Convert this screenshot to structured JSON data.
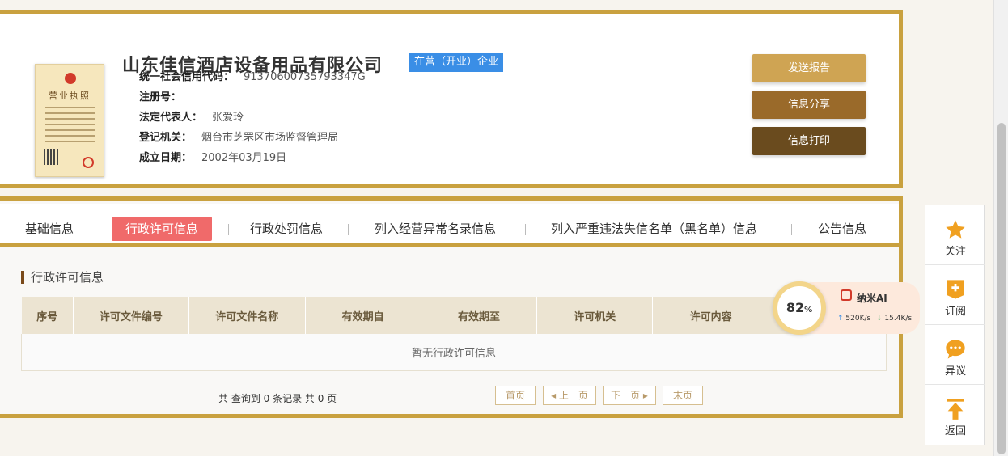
{
  "company": {
    "name": "山东佳信酒店设备用品有限公司",
    "status": "在营（开业）企业",
    "license_title": "营业执照",
    "fields": [
      {
        "label": "统一社会信用代码：",
        "value": "91370600735793347G"
      },
      {
        "label": "注册号：",
        "value": ""
      },
      {
        "label": "法定代表人：",
        "value": "张爱玲"
      },
      {
        "label": "登记机关：",
        "value": "烟台市芝罘区市场监督管理局"
      },
      {
        "label": "成立日期：",
        "value": "2002年03月19日"
      }
    ]
  },
  "actions": {
    "report": "发送报告",
    "share": "信息分享",
    "print": "信息打印"
  },
  "tabs": [
    {
      "label": "基础信息",
      "active": false
    },
    {
      "label": "行政许可信息",
      "active": true
    },
    {
      "label": "行政处罚信息",
      "active": false
    },
    {
      "label": "列入经营异常名录信息",
      "active": false
    },
    {
      "label": "列入严重违法失信名单（黑名单）信息",
      "active": false
    },
    {
      "label": "公告信息",
      "active": false
    }
  ],
  "section": {
    "title": "行政许可信息",
    "columns": [
      "序号",
      "许可文件编号",
      "许可文件名称",
      "有效期自",
      "有效期至",
      "许可机关",
      "许可内容",
      ""
    ],
    "empty_text": "暂无行政许可信息"
  },
  "pagination": {
    "summary": "共 查询到 0 条记录 共 0 页",
    "first": "首页",
    "prev": "上一页",
    "next": "下一页",
    "last": "末页"
  },
  "ai_widget": {
    "percent": "82",
    "percent_unit": "%",
    "name": "纳米AI",
    "upload": "520K/s",
    "download": "15.4K/s"
  },
  "sidebar": [
    {
      "label": "关注",
      "icon": "star-icon"
    },
    {
      "label": "订阅",
      "icon": "subscribe-icon"
    },
    {
      "label": "异议",
      "icon": "comment-icon"
    },
    {
      "label": "返回",
      "icon": "back-to-top-icon"
    }
  ],
  "colors": {
    "gold_border": "#c9a13f",
    "active_tab": "#f06a6a",
    "status_badge": "#3a8ee6",
    "icon_orange": "#f0a020"
  }
}
